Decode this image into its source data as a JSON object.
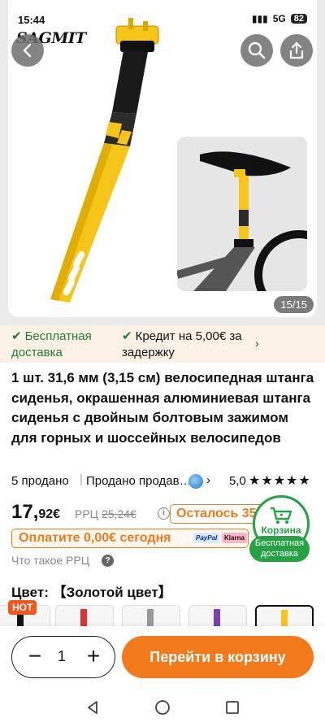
{
  "status": {
    "time": "15:44",
    "network": "5G",
    "battery": "82"
  },
  "gallery": {
    "logo": "SAGMIT",
    "counter": "15/15"
  },
  "benefits": {
    "free_delivery": "Бесплатная доставка",
    "credit": "Кредит на 5,00€ за задержку"
  },
  "product": {
    "title": "1 шт. 31,6 мм (3,15 см) велосипедная штанга сиденья, окрашенная алюминиевая штанга сиденья с двойным болтовым зажимом для горных и шоссейных велосипедов",
    "sold": "5 продано",
    "sold_by": "Продано продавцом",
    "rating": "5,0",
    "stars": "★★★★★",
    "price_int": "17,",
    "price_frac": "92€",
    "rrp_label": "РРЦ",
    "rrp_value": "25,24€",
    "left_badge": "Осталось 35",
    "pay_text": "Оплатите 0,00€ сегодня",
    "paypal": "PayPal",
    "klarna": "Klarna",
    "rrp_help": "Что такое РРЦ",
    "color_label": "Цвет:",
    "color_value": "【Золотой цвет】",
    "hot": "HOT"
  },
  "cart_fab": {
    "label": "Корзина",
    "free_delivery": "Бесплатная доставка"
  },
  "bottom": {
    "quantity": "1",
    "minus": "−",
    "plus": "+",
    "go_to_cart": "Перейти в корзину"
  },
  "colors": {
    "accent": "#f27a1a",
    "green": "#25a244",
    "yellow": "#f5c518"
  }
}
